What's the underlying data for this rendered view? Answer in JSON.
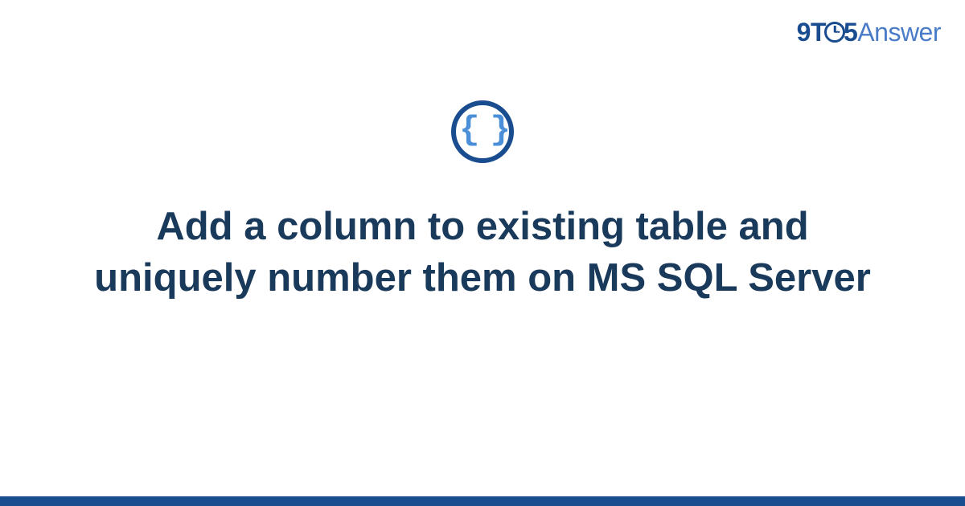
{
  "logo": {
    "part1": "9T",
    "part2": "5",
    "part3": "Answer"
  },
  "icon": {
    "name": "code-braces-icon",
    "glyph": "{ }"
  },
  "title": "Add a column to existing table and uniquely number them on MS SQL Server",
  "colors": {
    "primary": "#1a4d8f",
    "secondary": "#4a7bc8",
    "text": "#1a3a5c"
  }
}
